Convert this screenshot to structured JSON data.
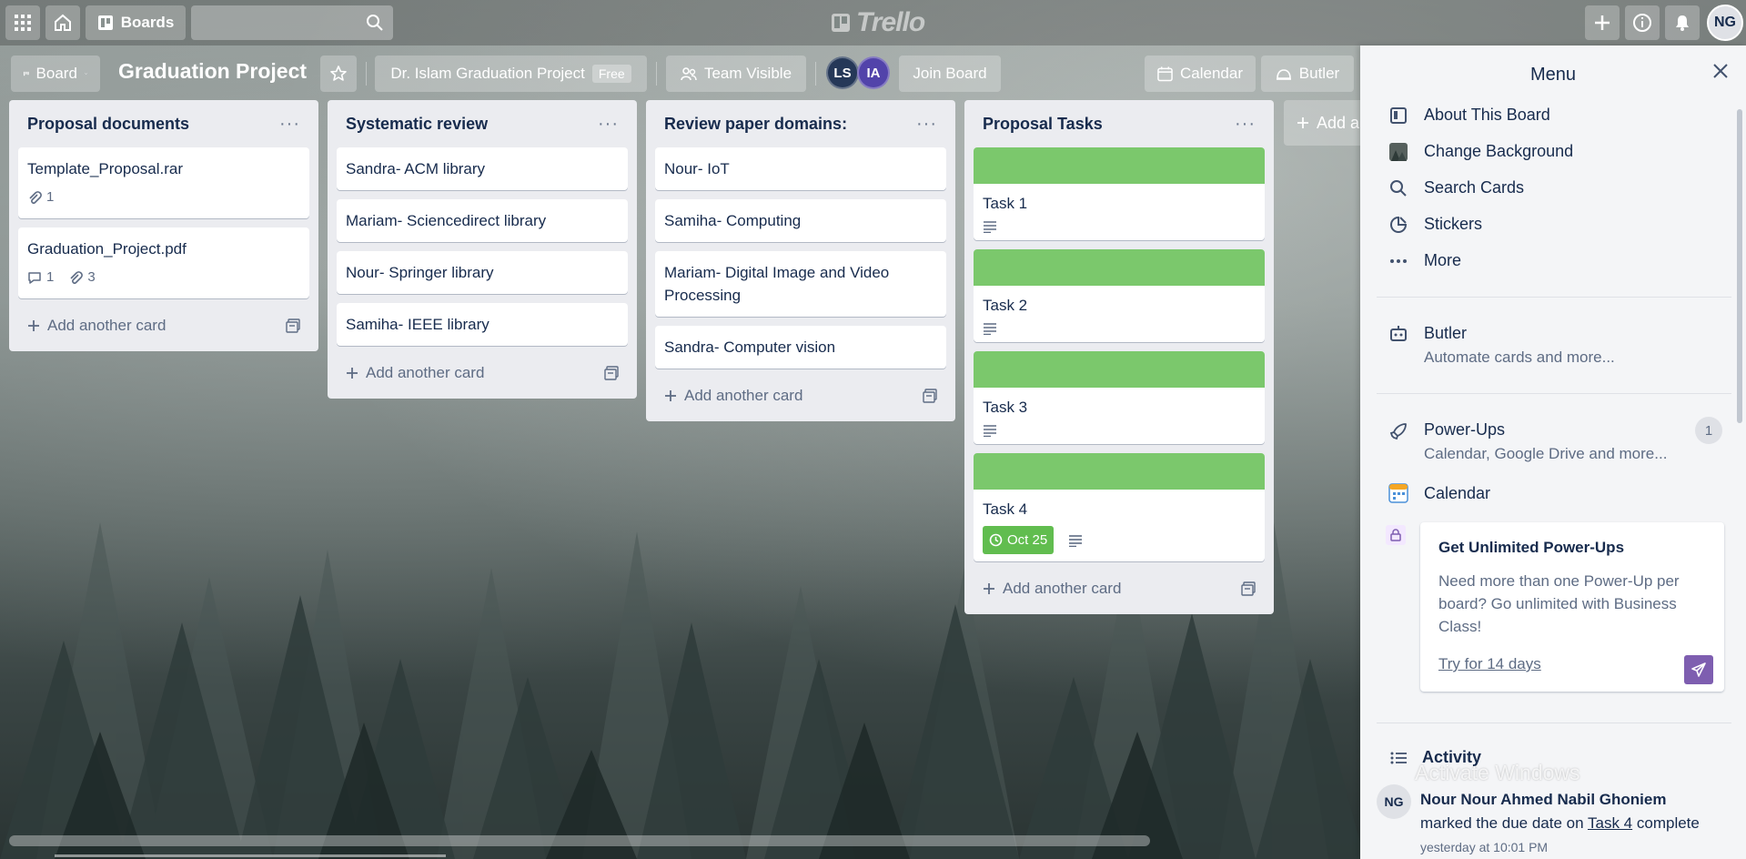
{
  "topnav": {
    "boards_label": "Boards",
    "search_placeholder": "",
    "logo_text": "Trello",
    "user_initials": "NG"
  },
  "board_header": {
    "view_label": "Board",
    "title": "Graduation Project",
    "team_name": "Dr. Islam Graduation Project",
    "team_badge": "Free",
    "visibility_label": "Team Visible",
    "members": [
      {
        "initials": "LS",
        "color": "#253858"
      },
      {
        "initials": "IA",
        "color": "#5243aa"
      }
    ],
    "join_label": "Join Board",
    "calendar_label": "Calendar",
    "butler_label": "Butler"
  },
  "lists": [
    {
      "title": "Proposal documents",
      "cards": [
        {
          "title": "Template_Proposal.rar",
          "attachments": "1"
        },
        {
          "title": "Graduation_Project.pdf",
          "comments": "1",
          "attachments": "3"
        }
      ],
      "add_label": "Add another card"
    },
    {
      "title": "Systematic review",
      "cards": [
        {
          "title": "Sandra- ACM library"
        },
        {
          "title": "Mariam- Sciencedirect library"
        },
        {
          "title": "Nour- Springer library"
        },
        {
          "title": "Samiha- IEEE library"
        }
      ],
      "add_label": "Add another card"
    },
    {
      "title": "Review paper domains:",
      "cards": [
        {
          "title": "Nour- IoT"
        },
        {
          "title": "Samiha- Computing"
        },
        {
          "title": "Mariam- Digital Image and Video Processing"
        },
        {
          "title": "Sandra- Computer vision"
        }
      ],
      "add_label": "Add another card"
    },
    {
      "title": "Proposal Tasks",
      "cards": [
        {
          "title": "Task 1",
          "cover_color": "#7bc86c"
        },
        {
          "title": "Task 2",
          "cover_color": "#7bc86c"
        },
        {
          "title": "Task 3",
          "cover_color": "#7bc86c"
        },
        {
          "title": "Task 4",
          "cover_color": "#7bc86c",
          "due": "Oct 25"
        }
      ],
      "add_label": "Add another card"
    }
  ],
  "add_list_label": "Add a",
  "menu": {
    "title": "Menu",
    "items": [
      {
        "label": "About This Board"
      },
      {
        "label": "Change Background"
      },
      {
        "label": "Search Cards"
      },
      {
        "label": "Stickers"
      },
      {
        "label": "More"
      }
    ],
    "butler": {
      "title": "Butler",
      "subtitle": "Automate cards and more..."
    },
    "powerups": {
      "title": "Power-Ups",
      "subtitle": "Calendar, Google Drive and more...",
      "count": "1"
    },
    "calendar_label": "Calendar",
    "promo": {
      "title": "Get Unlimited Power-Ups",
      "text": "Need more than one Power-Up per board? Go unlimited with Business Class!",
      "link": "Try for 14 days"
    },
    "activity": {
      "title": "Activity",
      "user_initials": "NG",
      "user_name": "Nour Nour Ahmed Nabil Ghoniem",
      "action_pre": "marked the due date on",
      "card_link": "Task 4",
      "action_post": "complete",
      "time": "yesterday at 10:01 PM"
    }
  },
  "watermark": "Activate Windows",
  "colors": {
    "list_bg": "#ebecf0",
    "label_green": "#7bc86c",
    "due_complete": "#61bd4f",
    "promo_accent": "#7e5eb0"
  }
}
